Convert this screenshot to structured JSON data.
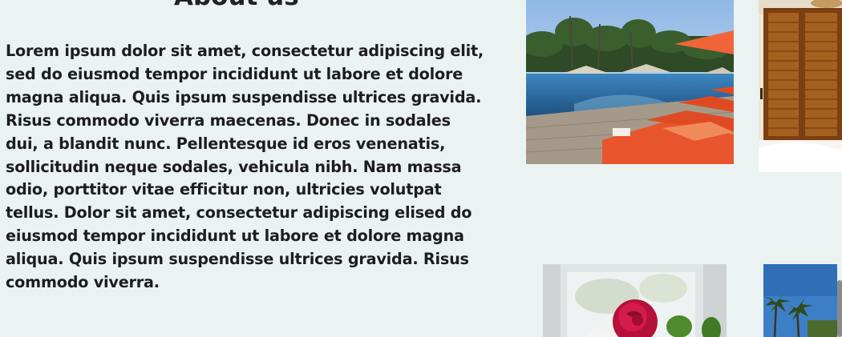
{
  "about": {
    "heading": "About us",
    "body": "Lorem ipsum dolor sit amet, consectetur adipiscing elit, sed do eiusmod tempor incididunt ut labore et dolore magna aliqua. Quis ipsum suspendisse ultrices gravida. Risus commodo viverra maecenas. Donec in sodales dui, a blandit nunc. Pellentesque id eros venenatis, sollicitudin neque sodales, vehicula nibh. Nam massa odio, porttitor vitae efficitur non, ultricies volutpat tellus. Dolor sit amet, consectetur adipiscing elised do eiusmod tempor incididunt ut labore et dolore magna aliqua. Quis ipsum suspendisse ultrices gravida. Risus commodo viverra."
  },
  "gallery": {
    "images": [
      {
        "name": "pool-loungers-photo"
      },
      {
        "name": "wooden-shutters-room-photo"
      },
      {
        "name": "red-rose-photo"
      },
      {
        "name": "palm-trees-sky-photo"
      }
    ]
  },
  "colors": {
    "background": "#ebf3f2",
    "text": "#1d1d1d",
    "lounger_orange": "#e8542c",
    "pool_blue": "#2f6fa3",
    "wood_brown": "#9a5a22",
    "rose_red": "#c8103f",
    "sky_blue": "#3d7fc6"
  }
}
